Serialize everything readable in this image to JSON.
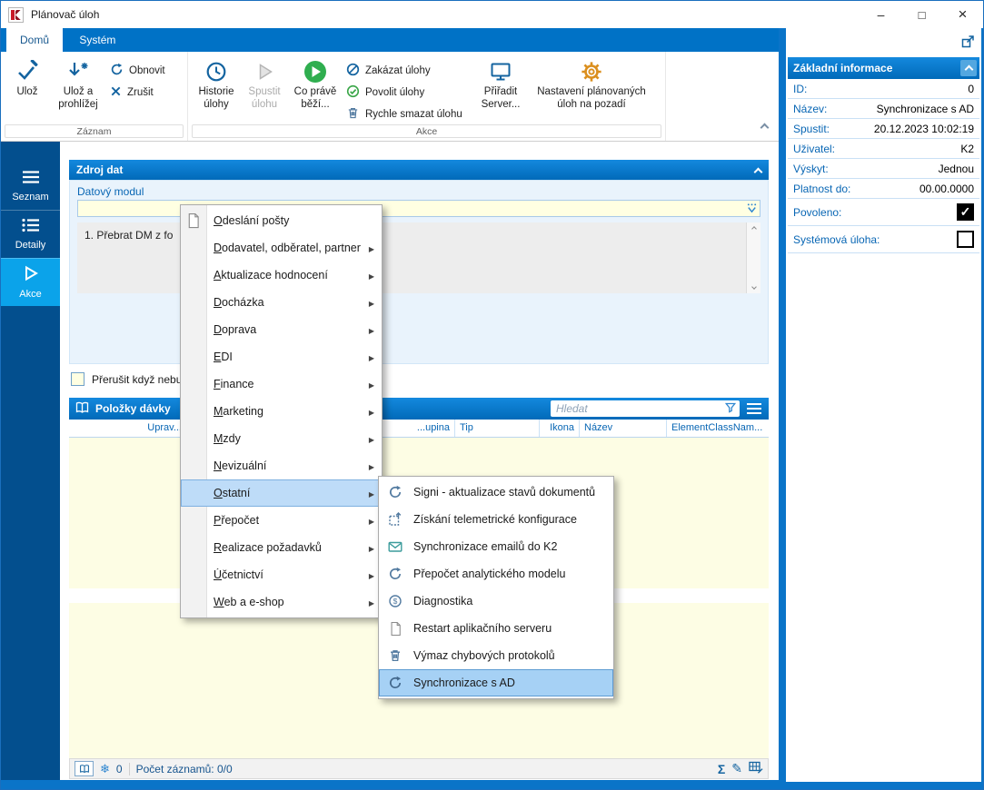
{
  "window": {
    "title": "Plánovač úloh"
  },
  "tabs": {
    "home": "Domů",
    "system": "Systém"
  },
  "ribbon": {
    "record_group": {
      "label": "Záznam",
      "save": "Ulož",
      "save_and_view": "Ulož a prohlížej",
      "refresh": "Obnovit",
      "cancel": "Zrušit"
    },
    "action_group": {
      "label": "Akce",
      "history": "Historie úlohy",
      "run_task": "Spustit úlohu",
      "running_now": "Co právě běží...",
      "disable_tasks": "Zakázat úlohy",
      "enable_tasks": "Povolit úlohy",
      "quick_delete": "Rychle smazat úlohu",
      "assign_server": "Přiřadit Server...",
      "background_settings": "Nastavení plánovaných úloh na pozadí"
    }
  },
  "sidebar": {
    "items": [
      {
        "label": "Seznam"
      },
      {
        "label": "Detaily"
      },
      {
        "label": "Akce",
        "active": true
      }
    ]
  },
  "source_section": {
    "title": "Zdroj dat",
    "field_label": "Datový modul",
    "field_value": "",
    "memo_line": "1. Přebrat DM z fo",
    "checkbox_label": "Přerušit když nebu"
  },
  "batch_section": {
    "title": "Položky dávky",
    "search_placeholder": "Hledat",
    "columns": [
      "Uprav...",
      "...upina",
      "Tip",
      "Ikona",
      "Název",
      "ElementClassNam..."
    ]
  },
  "status_bar": {
    "badge": "0",
    "count_label": "Počet záznamů: 0/0"
  },
  "context_menu": {
    "items": [
      {
        "label": "Odeslání pošty",
        "icon": "document-icon"
      },
      {
        "label": "Dodavatel, odběratel, partner",
        "submenu": true
      },
      {
        "label": "Aktualizace hodnocení",
        "submenu": true
      },
      {
        "label": "Docházka",
        "submenu": true
      },
      {
        "label": "Doprava",
        "submenu": true
      },
      {
        "label": "EDI",
        "submenu": true
      },
      {
        "label": "Finance",
        "submenu": true
      },
      {
        "label": "Marketing",
        "submenu": true
      },
      {
        "label": "Mzdy",
        "submenu": true
      },
      {
        "label": "Nevizuální",
        "submenu": true
      },
      {
        "label": "Ostatní",
        "submenu": true,
        "highlighted": true
      },
      {
        "label": "Přepočet",
        "submenu": true
      },
      {
        "label": "Realizace požadavků",
        "submenu": true
      },
      {
        "label": "Účetnictví",
        "submenu": true
      },
      {
        "label": "Web a e-shop",
        "submenu": true
      }
    ]
  },
  "submenu": {
    "items": [
      {
        "label": "Signi - aktualizace stavů dokumentů",
        "icon": "refresh-icon"
      },
      {
        "label": "Získání telemetrické konfigurace",
        "icon": "import-icon"
      },
      {
        "label": "Synchronizace emailů do K2",
        "icon": "mail-icon"
      },
      {
        "label": "Přepočet analytického modelu",
        "icon": "refresh-icon"
      },
      {
        "label": "Diagnostika",
        "icon": "diagnostics-icon"
      },
      {
        "label": "Restart aplikačního serveru",
        "icon": "document-icon"
      },
      {
        "label": "Výmaz chybových protokolů",
        "icon": "delete-icon"
      },
      {
        "label": "Synchronizace s AD",
        "icon": "refresh-icon",
        "highlighted": true
      }
    ]
  },
  "info_panel": {
    "title": "Základní informace",
    "fields": [
      {
        "label": "ID:",
        "value": "0"
      },
      {
        "label": "Název:",
        "value": "Synchronizace s AD"
      },
      {
        "label": "Spustit:",
        "value": "20.12.2023 10:02:19"
      },
      {
        "label": "Uživatel:",
        "value": "K2"
      },
      {
        "label": "Výskyt:",
        "value": "Jednou"
      },
      {
        "label": "Platnost do:",
        "value": "00.00.0000"
      }
    ],
    "checkboxes": [
      {
        "label": "Povoleno:",
        "checked": true
      },
      {
        "label": "Systémová úloha:",
        "checked": false
      }
    ]
  },
  "colors": {
    "accent_blue": "#0072C6",
    "frame_blue": "#0A74C8",
    "sidebar_navy": "#034F8E",
    "sidebar_active": "#0BA3EA",
    "field_yellow": "#FFFFE2",
    "selection_blue": "#BEDCF8"
  }
}
